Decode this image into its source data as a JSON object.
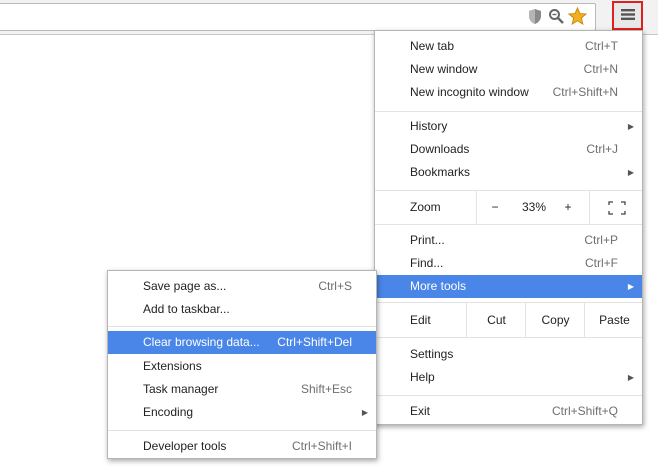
{
  "toolbar": {
    "shield_icon": "shield-icon",
    "zoom_icon": "magnifier-icon",
    "star_icon": "star-icon",
    "star_color": "#f2b021",
    "menu_icon": "hamburger-menu-icon",
    "menu_highlight_color": "#e0201e"
  },
  "main_menu": {
    "new_tab": {
      "label": "New tab",
      "shortcut": "Ctrl+T"
    },
    "new_window": {
      "label": "New window",
      "shortcut": "Ctrl+N"
    },
    "new_incognito": {
      "label": "New incognito window",
      "shortcut": "Ctrl+Shift+N"
    },
    "history": {
      "label": "History"
    },
    "downloads": {
      "label": "Downloads",
      "shortcut": "Ctrl+J"
    },
    "bookmarks": {
      "label": "Bookmarks"
    },
    "zoom": {
      "label": "Zoom",
      "minus": "−",
      "value": "33%",
      "plus": "+"
    },
    "print": {
      "label": "Print...",
      "shortcut": "Ctrl+P"
    },
    "find": {
      "label": "Find...",
      "shortcut": "Ctrl+F"
    },
    "more_tools": {
      "label": "More tools"
    },
    "edit": {
      "label": "Edit",
      "cut": "Cut",
      "copy": "Copy",
      "paste": "Paste"
    },
    "settings": {
      "label": "Settings"
    },
    "help": {
      "label": "Help"
    },
    "exit": {
      "label": "Exit",
      "shortcut": "Ctrl+Shift+Q"
    }
  },
  "submenu": {
    "save_page": {
      "label": "Save page as...",
      "shortcut": "Ctrl+S"
    },
    "add_taskbar": {
      "label": "Add to taskbar..."
    },
    "clear_data": {
      "label": "Clear browsing data...",
      "shortcut": "Ctrl+Shift+Del"
    },
    "extensions": {
      "label": "Extensions"
    },
    "task_manager": {
      "label": "Task manager",
      "shortcut": "Shift+Esc"
    },
    "encoding": {
      "label": "Encoding"
    },
    "dev_tools": {
      "label": "Developer tools",
      "shortcut": "Ctrl+Shift+I"
    }
  },
  "highlight_color": "#4a86e8"
}
